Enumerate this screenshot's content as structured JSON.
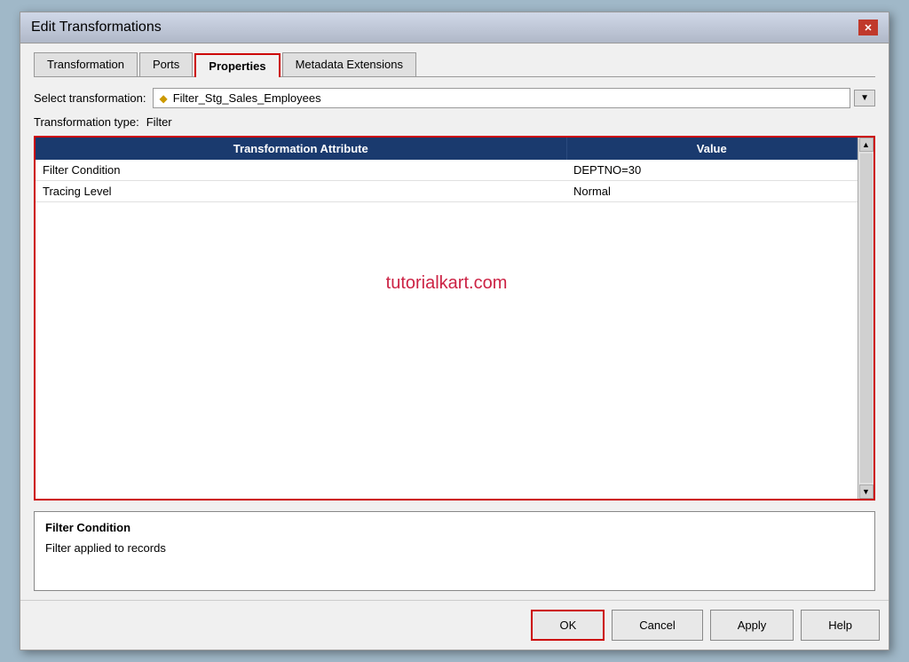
{
  "dialog": {
    "title": "Edit Transformations"
  },
  "tabs": [
    {
      "label": "Transformation",
      "active": false
    },
    {
      "label": "Ports",
      "active": false
    },
    {
      "label": "Properties",
      "active": true
    },
    {
      "label": "Metadata Extensions",
      "active": false
    }
  ],
  "form": {
    "select_label": "Select transformation:",
    "select_value": "Filter_Stg_Sales_Employees",
    "type_label": "Transformation type:",
    "type_value": "Filter"
  },
  "table": {
    "columns": [
      "Transformation Attribute",
      "Value"
    ],
    "rows": [
      {
        "attribute": "Filter Condition",
        "value": "DEPTNO=30"
      },
      {
        "attribute": "Tracing Level",
        "value": "Normal"
      }
    ]
  },
  "watermark": "tutorialkart.com",
  "info_panel": {
    "title": "Filter Condition",
    "description": "Filter applied to records"
  },
  "buttons": {
    "ok": "OK",
    "cancel": "Cancel",
    "apply": "Apply",
    "help": "Help"
  }
}
